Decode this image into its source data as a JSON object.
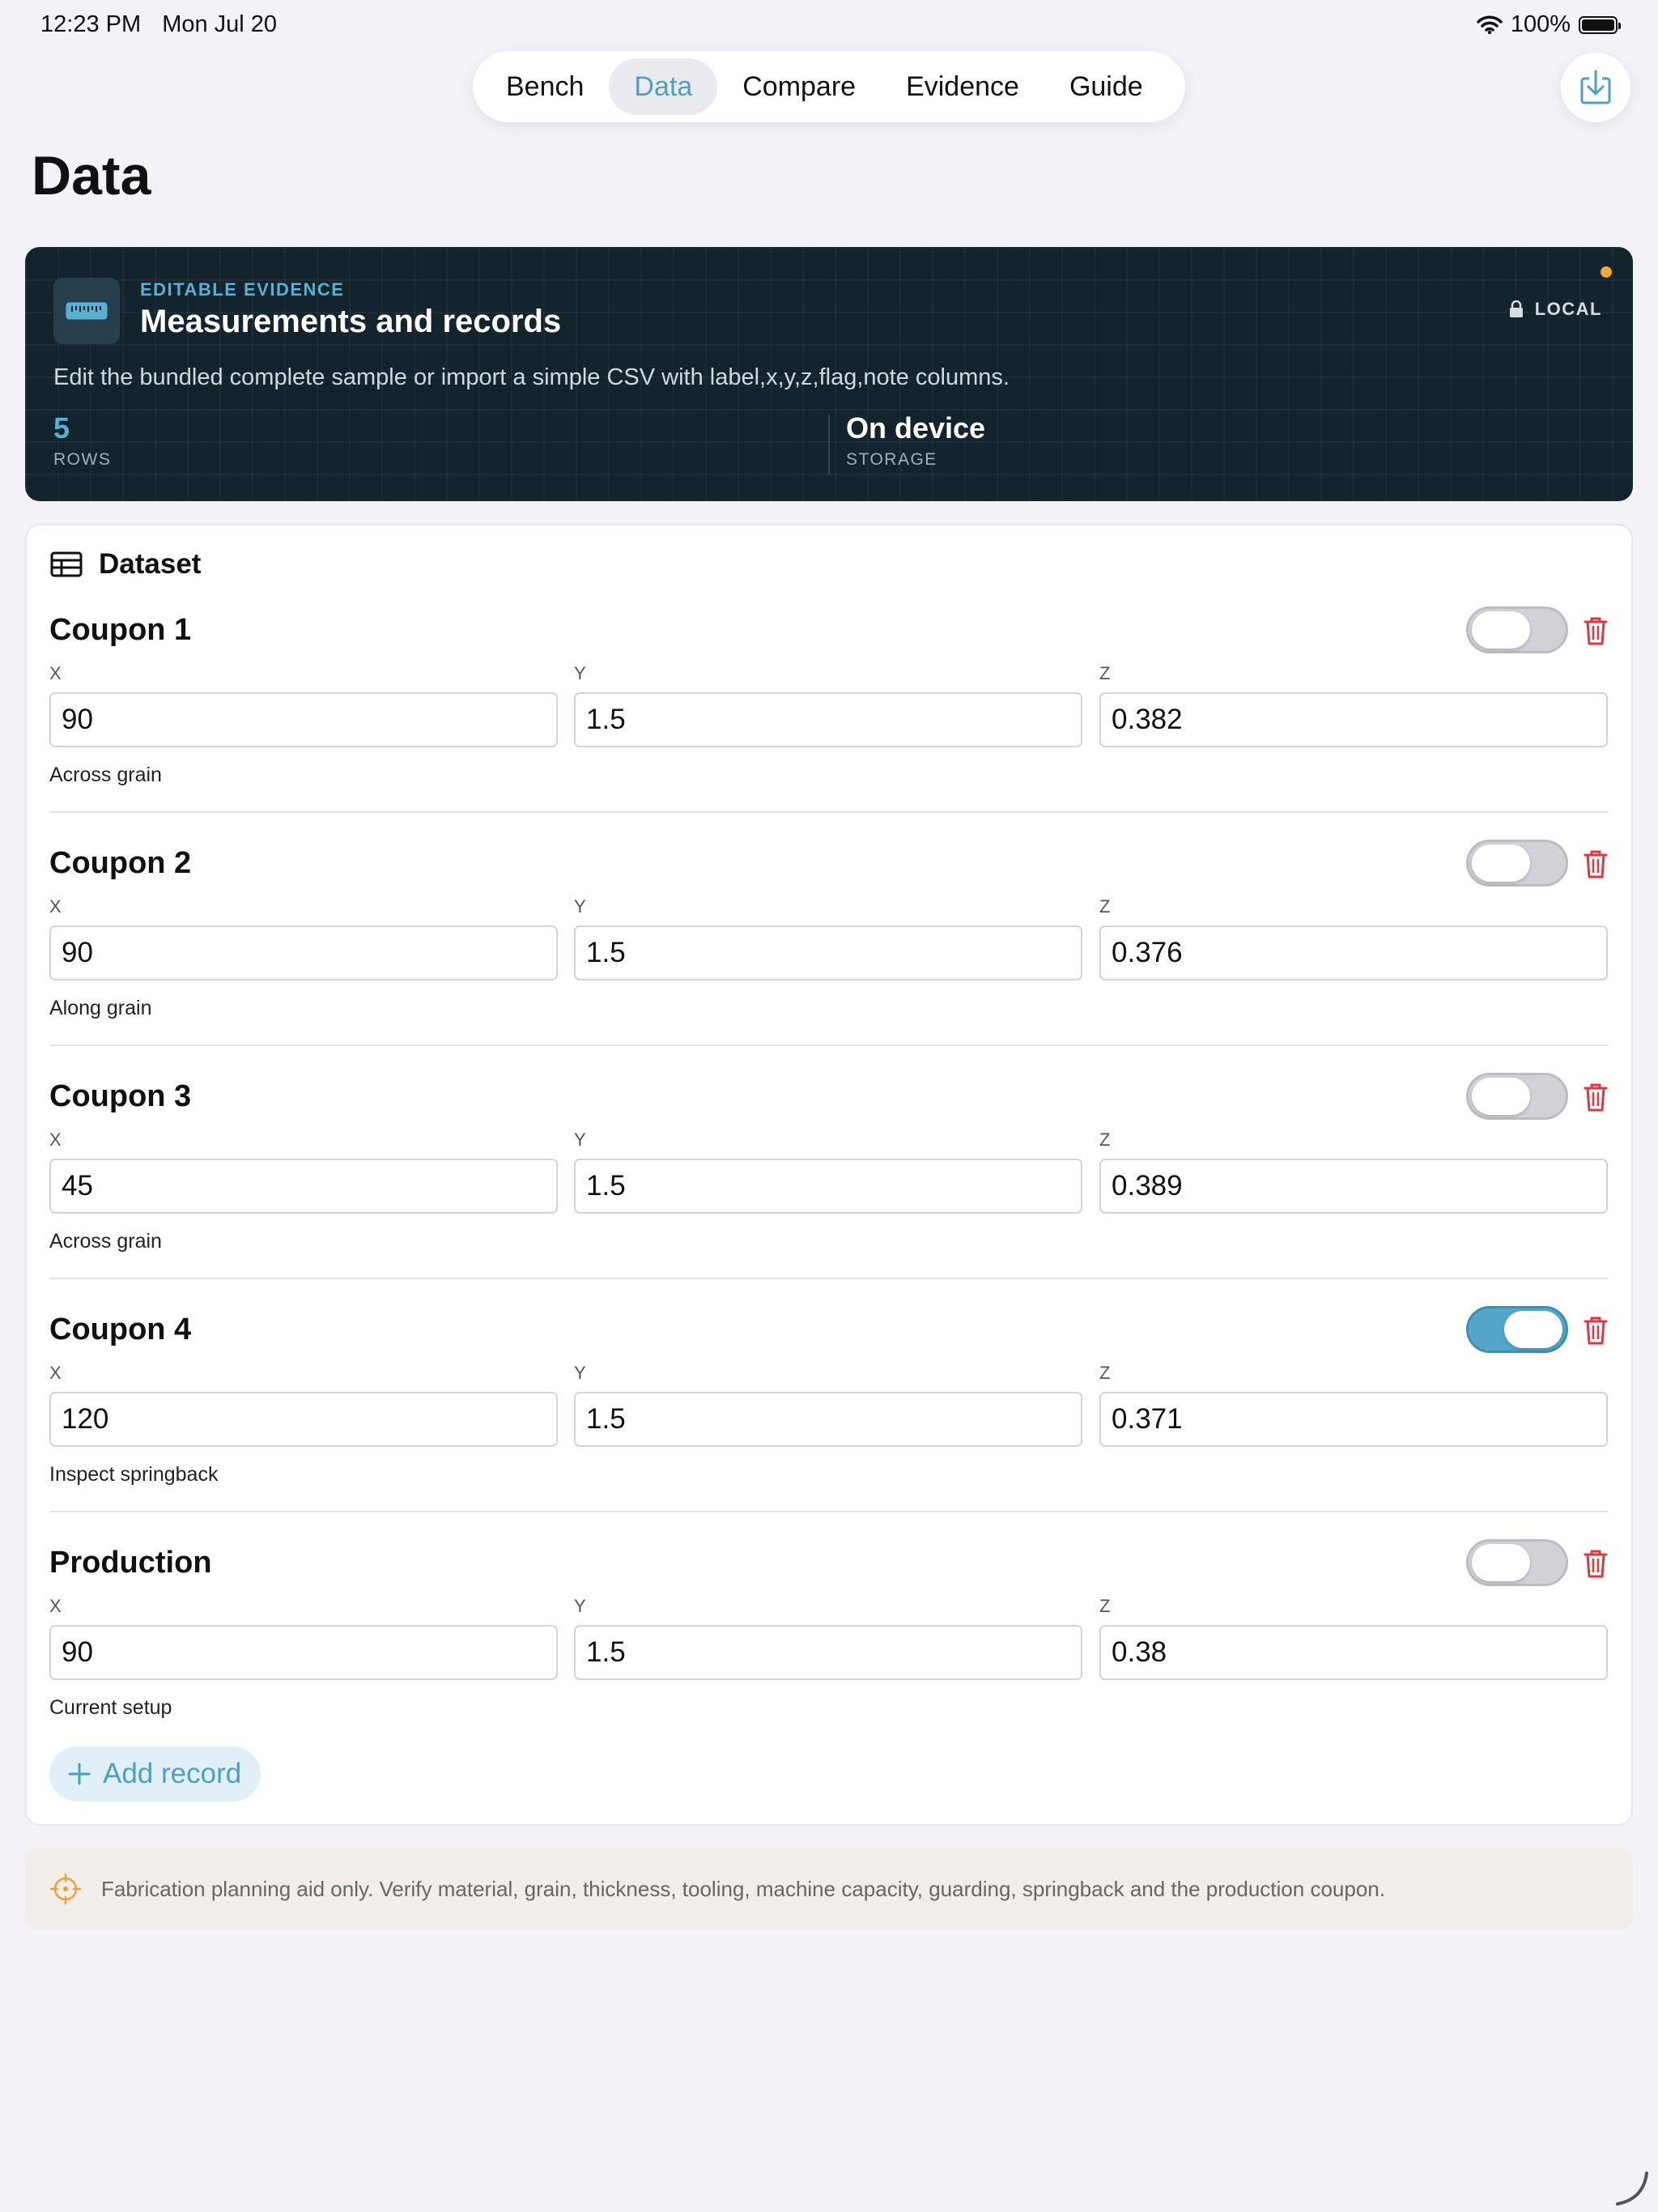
{
  "status": {
    "time": "12:23 PM",
    "date": "Mon Jul 20",
    "battery": "100%"
  },
  "tabs": [
    {
      "label": "Bench",
      "active": false
    },
    {
      "label": "Data",
      "active": true
    },
    {
      "label": "Compare",
      "active": false
    },
    {
      "label": "Evidence",
      "active": false
    },
    {
      "label": "Guide",
      "active": false
    }
  ],
  "page": {
    "title": "Data"
  },
  "hero": {
    "eyebrow": "EDITABLE EVIDENCE",
    "title": "Measurements and records",
    "badge": "LOCAL",
    "description": "Edit the bundled complete sample or import a simple CSV with label,x,y,z,flag,note columns.",
    "stats": [
      {
        "value": "5",
        "label": "ROWS"
      },
      {
        "value": "On device",
        "label": "STORAGE"
      }
    ],
    "accent": "#5ab0d2",
    "dot_color": "#f0a63a"
  },
  "dataset": {
    "title": "Dataset",
    "field_labels": {
      "x": "X",
      "y": "Y",
      "z": "Z"
    },
    "records": [
      {
        "label": "Coupon 1",
        "x": "90",
        "y": "1.5",
        "z": "0.382",
        "note": "Across grain",
        "flag": false
      },
      {
        "label": "Coupon 2",
        "x": "90",
        "y": "1.5",
        "z": "0.376",
        "note": "Along grain",
        "flag": false
      },
      {
        "label": "Coupon 3",
        "x": "45",
        "y": "1.5",
        "z": "0.389",
        "note": "Across grain",
        "flag": false
      },
      {
        "label": "Coupon 4",
        "x": "120",
        "y": "1.5",
        "z": "0.371",
        "note": "Inspect springback",
        "flag": true
      },
      {
        "label": "Production",
        "x": "90",
        "y": "1.5",
        "z": "0.38",
        "note": "Current setup",
        "flag": false
      }
    ],
    "add_label": "Add record"
  },
  "disclaimer": "Fabrication planning aid only. Verify material, grain, thickness, tooling, machine capacity, guarding, springback and the production coupon.",
  "colors": {
    "accent": "#4e9fc2",
    "danger": "#e0383e",
    "toggle_on": "#55a6c8"
  }
}
